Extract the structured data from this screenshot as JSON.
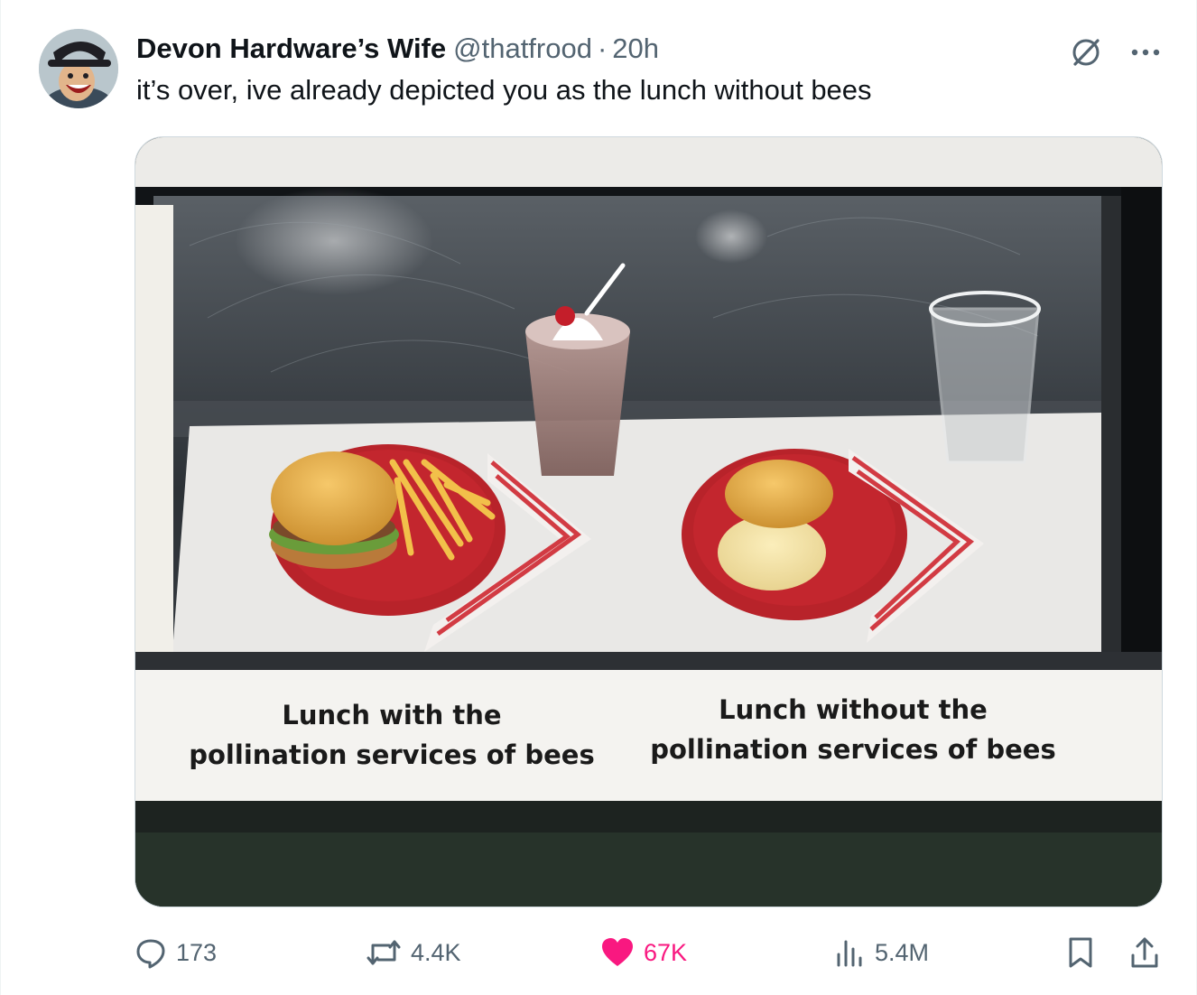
{
  "author": {
    "display_name": "Devon Hardware’s Wife",
    "handle": "@thatfrood",
    "separator": "·",
    "time": "20h"
  },
  "post": {
    "text": "it’s over, ive already depicted you as the lunch without bees"
  },
  "media": {
    "caption_left_line1": "Lunch with the",
    "caption_left_line2": "pollination services of bees",
    "caption_right_line1": "Lunch without the",
    "caption_right_line2": "pollination services of bees"
  },
  "actions": {
    "replies": "173",
    "reposts": "4.4K",
    "likes": "67K",
    "views": "5.4M"
  },
  "icons": {
    "reply": "reply-icon",
    "repost": "repost-icon",
    "like": "heart-icon",
    "views": "views-icon",
    "bookmark": "bookmark-icon",
    "share": "share-icon",
    "grok": "grok-icon",
    "more": "more-icon"
  },
  "colors": {
    "like_active": "#f91880",
    "secondary_text": "#536471",
    "primary_text": "#0f1419"
  }
}
